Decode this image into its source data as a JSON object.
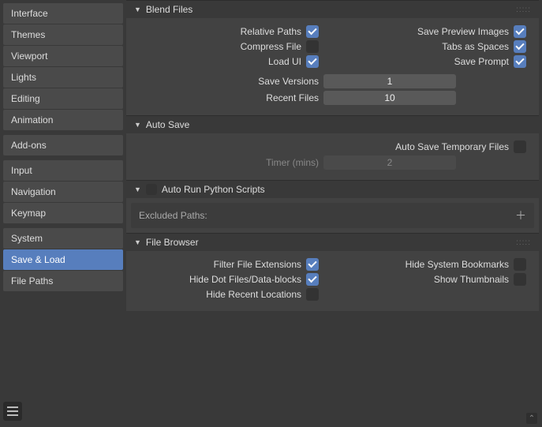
{
  "sidebar": {
    "groups": [
      [
        "Interface",
        "Themes",
        "Viewport",
        "Lights",
        "Editing",
        "Animation"
      ],
      [
        "Add-ons"
      ],
      [
        "Input",
        "Navigation",
        "Keymap"
      ],
      [
        "System",
        "Save & Load",
        "File Paths"
      ]
    ],
    "active": "Save & Load"
  },
  "panels": {
    "blend": {
      "title": "Blend Files",
      "relative_paths": "Relative Paths",
      "compress_file": "Compress File",
      "load_ui": "Load UI",
      "save_preview": "Save Preview Images",
      "tabs_spaces": "Tabs as Spaces",
      "save_prompt": "Save Prompt",
      "save_versions_lbl": "Save Versions",
      "save_versions": "1",
      "recent_files_lbl": "Recent Files",
      "recent_files": "10"
    },
    "autosave": {
      "title": "Auto Save",
      "auto_save_temp": "Auto Save Temporary Files",
      "timer_lbl": "Timer (mins)",
      "timer": "2"
    },
    "autorun": {
      "title": "Auto Run Python Scripts",
      "excluded": "Excluded Paths:"
    },
    "browser": {
      "title": "File Browser",
      "filter_ext": "Filter File Extensions",
      "hide_dot": "Hide Dot Files/Data-blocks",
      "hide_recent": "Hide Recent Locations",
      "hide_sys": "Hide System Bookmarks",
      "show_thumb": "Show Thumbnails"
    }
  }
}
